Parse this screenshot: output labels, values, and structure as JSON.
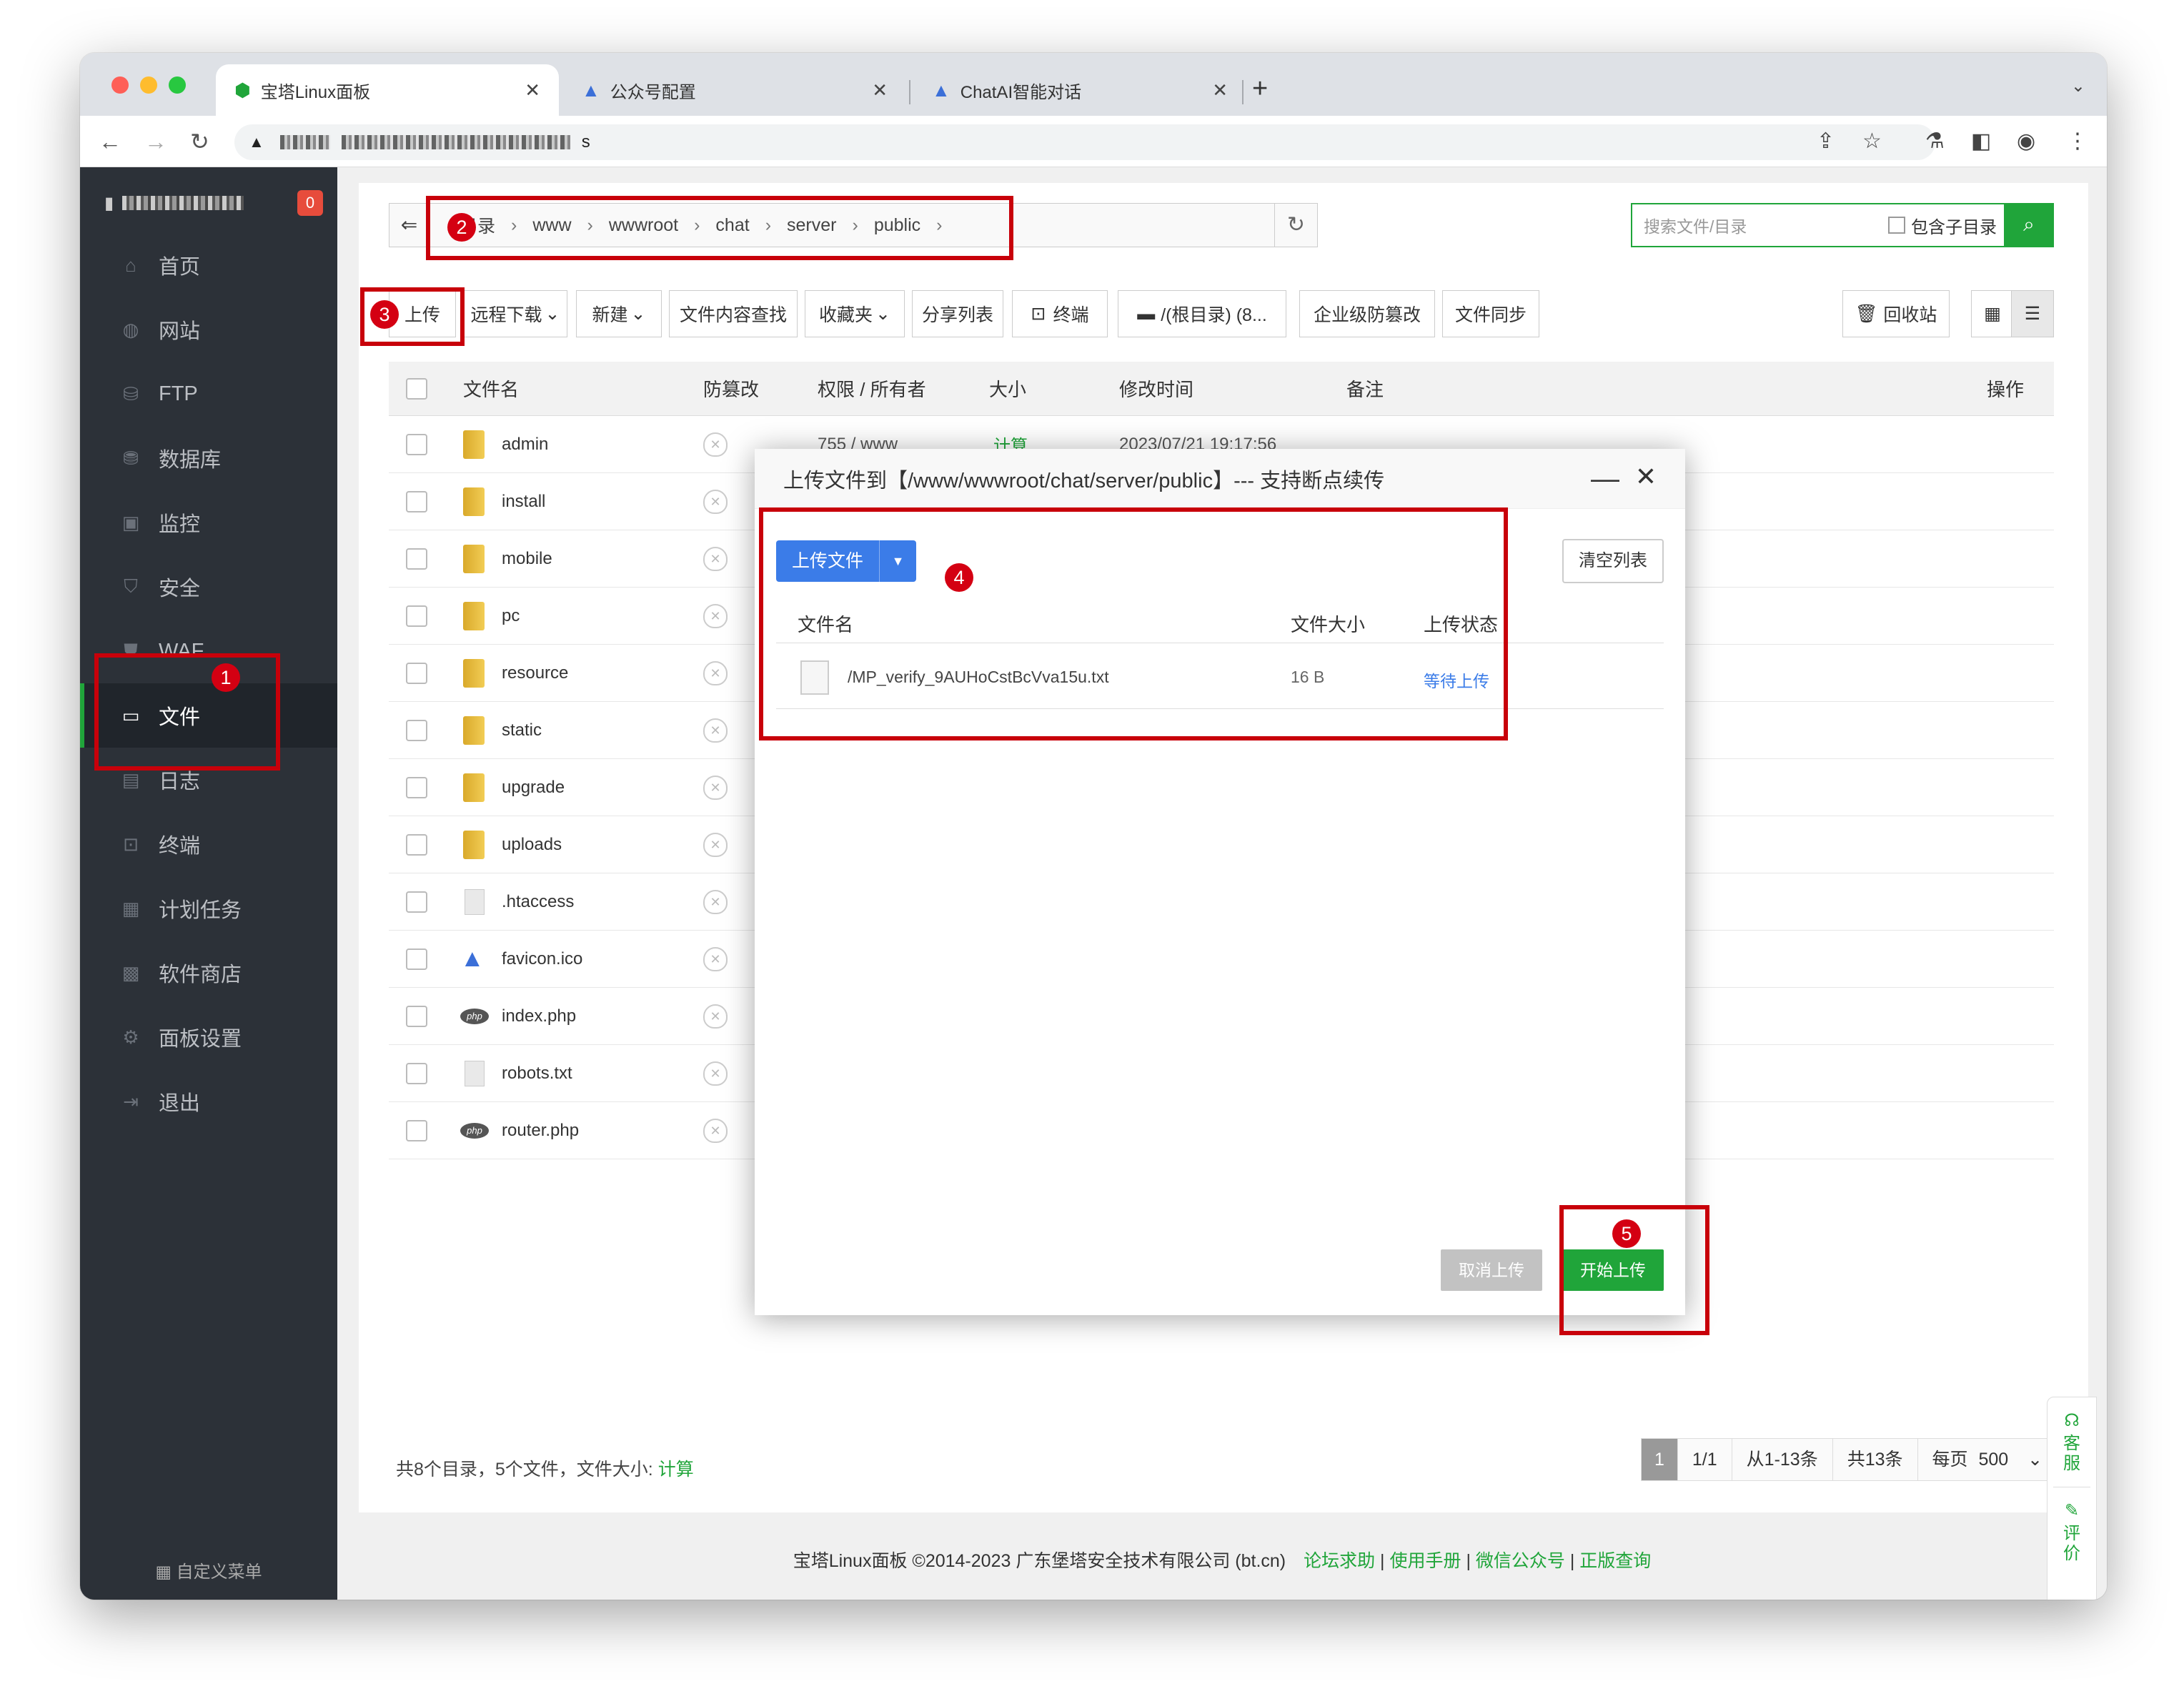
{
  "browser": {
    "tabs": [
      {
        "title": "宝塔Linux面板",
        "icon": "baota-shield-icon",
        "active": true
      },
      {
        "title": "公众号配置",
        "icon": "app-logo-icon",
        "active": false
      },
      {
        "title": "ChatAI智能对话",
        "icon": "app-logo-icon",
        "active": false
      }
    ],
    "new_tab": "+",
    "address_suffix": "s"
  },
  "sidebar": {
    "badge": "0",
    "items": [
      {
        "label": "首页",
        "icon": "home-icon"
      },
      {
        "label": "网站",
        "icon": "globe-icon"
      },
      {
        "label": "FTP",
        "icon": "ftp-icon"
      },
      {
        "label": "数据库",
        "icon": "database-icon"
      },
      {
        "label": "监控",
        "icon": "monitor-icon"
      },
      {
        "label": "安全",
        "icon": "shield-icon"
      },
      {
        "label": "WAF",
        "icon": "waf-icon"
      },
      {
        "label": "文件",
        "icon": "folder-icon",
        "active": true
      },
      {
        "label": "日志",
        "icon": "log-icon"
      },
      {
        "label": "终端",
        "icon": "terminal-icon"
      },
      {
        "label": "计划任务",
        "icon": "calendar-icon"
      },
      {
        "label": "软件商店",
        "icon": "apps-icon"
      },
      {
        "label": "面板设置",
        "icon": "gear-icon"
      },
      {
        "label": "退出",
        "icon": "logout-icon"
      }
    ],
    "footer": "自定义菜单"
  },
  "breadcrumb": {
    "segments": [
      "目录",
      "www",
      "wwwroot",
      "chat",
      "server",
      "public"
    ]
  },
  "search": {
    "placeholder": "搜索文件/目录",
    "include_subdir": "包含子目录"
  },
  "toolbar": {
    "upload": "上传",
    "remote_download": "远程下载",
    "new": "新建",
    "content_search": "文件内容查找",
    "favorites": "收藏夹",
    "share_list": "分享列表",
    "terminal": "终端",
    "disk": "/(根目录) (8...",
    "tamper_proof": "企业级防篡改",
    "file_sync": "文件同步",
    "recycle_bin": "回收站"
  },
  "table": {
    "headers": {
      "name": "文件名",
      "tamper": "防篡改",
      "perm": "权限 / 所有者",
      "size": "大小",
      "mtime": "修改时间",
      "note": "备注",
      "ops": "操作"
    },
    "rows": [
      {
        "name": "admin",
        "type": "folder",
        "perm": "755 / www",
        "size": "计算",
        "mtime": "2023/07/21 19:17:56"
      },
      {
        "name": "install",
        "type": "folder"
      },
      {
        "name": "mobile",
        "type": "folder"
      },
      {
        "name": "pc",
        "type": "folder"
      },
      {
        "name": "resource",
        "type": "folder"
      },
      {
        "name": "static",
        "type": "folder"
      },
      {
        "name": "upgrade",
        "type": "folder"
      },
      {
        "name": "uploads",
        "type": "folder"
      },
      {
        "name": ".htaccess",
        "type": "file"
      },
      {
        "name": "favicon.ico",
        "type": "ico"
      },
      {
        "name": "index.php",
        "type": "php"
      },
      {
        "name": "robots.txt",
        "type": "file"
      },
      {
        "name": "router.php",
        "type": "php"
      }
    ]
  },
  "summary": {
    "text": "共8个目录，5个文件，文件大小:",
    "calc": "计算"
  },
  "pager": {
    "current": "1",
    "pages": "1/1",
    "range": "从1-13条",
    "total": "共13条",
    "per_page_label": "每页",
    "per_page": "500",
    "unit": "条"
  },
  "copyright": {
    "text": "宝塔Linux面板 ©2014-2023 广东堡塔安全技术有限公司 (bt.cn)",
    "links": [
      "论坛求助",
      "使用手册",
      "微信公众号",
      "正版查询"
    ]
  },
  "side_widget": {
    "service": "客服",
    "review": "评价"
  },
  "modal": {
    "title": "上传文件到【/www/wwwroot/chat/server/public】--- 支持断点续传",
    "upload_button": "上传文件",
    "clear_button": "清空列表",
    "headers": {
      "name": "文件名",
      "size": "文件大小",
      "status": "上传状态"
    },
    "file": {
      "name": "/MP_verify_9AUHoCstBcVva15u.txt",
      "size": "16 B",
      "status": "等待上传"
    },
    "cancel_button": "取消上传",
    "start_button": "开始上传"
  },
  "annotations": [
    "1",
    "2",
    "3",
    "4",
    "5"
  ],
  "colors": {
    "brand_green": "#20a53a",
    "sidebar_bg": "#2c3138",
    "annotation_red": "#c8000a",
    "upload_blue": "#3b7ce8"
  }
}
